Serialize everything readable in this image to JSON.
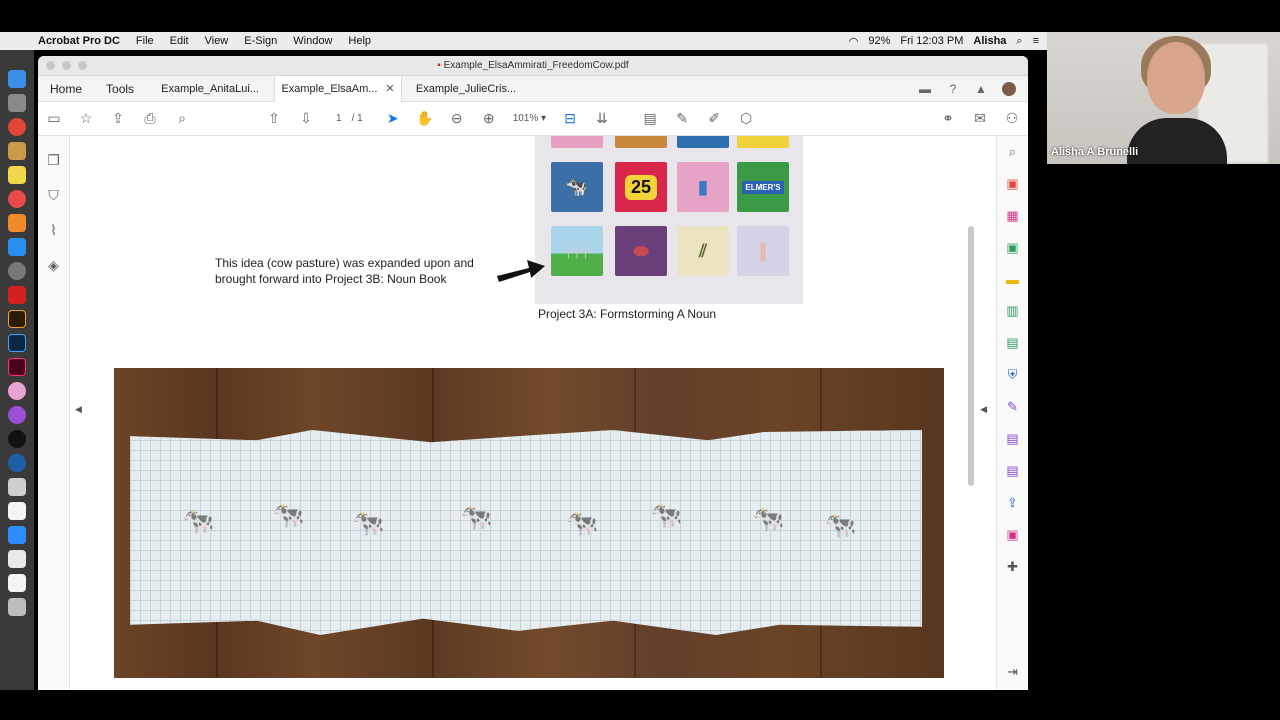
{
  "menubar": {
    "app": "Acrobat Pro DC",
    "items": [
      "File",
      "Edit",
      "View",
      "E-Sign",
      "Window",
      "Help"
    ],
    "battery": "92%",
    "clock": "Fri 12:03 PM",
    "user": "Alisha"
  },
  "window": {
    "title": "Example_ElsaAmmirati_FreedomCow.pdf"
  },
  "tabs": {
    "home": "Home",
    "tools": "Tools",
    "docs": [
      {
        "label": "Example_AnitaLui..."
      },
      {
        "label": "Example_ElsaAm..."
      },
      {
        "label": "Example_JulieCris..."
      }
    ]
  },
  "toolbar": {
    "page_current": "1",
    "page_total": "/ 1",
    "zoom": "101%"
  },
  "document": {
    "arrow_caption": "This idea (cow pasture) was expanded upon and brought forward into Project 3B: Noun Book",
    "grid_caption": "Project 3A: Formstorming A Noun",
    "card_number": "25",
    "card_brand": "ELMER'S"
  },
  "video": {
    "name": "Alisha A Brunelli"
  },
  "colors": {
    "accent": "#1473e6",
    "wood": "#6b4426"
  }
}
